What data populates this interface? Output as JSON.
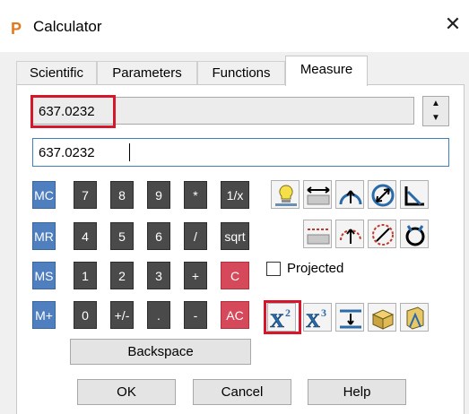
{
  "window": {
    "title": "Calculator",
    "close_glyph": "✕",
    "app_icon_letter": "P"
  },
  "tabs": [
    {
      "label": "Scientific",
      "active": false
    },
    {
      "label": "Parameters",
      "active": false
    },
    {
      "label": "Functions",
      "active": false
    },
    {
      "label": "Measure",
      "active": true
    }
  ],
  "display": {
    "value": "637.0232"
  },
  "entry": {
    "value": "637.0232"
  },
  "keypad": {
    "rows": [
      [
        "MC",
        "7",
        "8",
        "9",
        "*",
        "1/x"
      ],
      [
        "MR",
        "4",
        "5",
        "6",
        "/",
        "sqrt"
      ],
      [
        "MS",
        "1",
        "2",
        "3",
        "+",
        "C"
      ],
      [
        "M+",
        "0",
        "+/-",
        ".",
        "-",
        "AC"
      ]
    ],
    "backspace": "Backspace"
  },
  "measure": {
    "projected_label": "Projected",
    "projected_checked": false,
    "icons": [
      "measure-object-icon",
      "distance-icon",
      "arc-radius-icon",
      "diameter-icon",
      "angle-icon",
      "distance-between-points-icon",
      "arc-three-point-icon",
      "circle-diameter-icon",
      "rotation-icon",
      "square-icon",
      "cube-icon",
      "thickness-icon",
      "volume-icon",
      "mass-properties-icon"
    ]
  },
  "footer": {
    "ok": "OK",
    "cancel": "Cancel",
    "help": "Help"
  },
  "colors": {
    "highlight": "#d6162a",
    "memory_key": "#4f7fbf",
    "number_key": "#4a4a4a",
    "clear_key": "#d5495a"
  }
}
